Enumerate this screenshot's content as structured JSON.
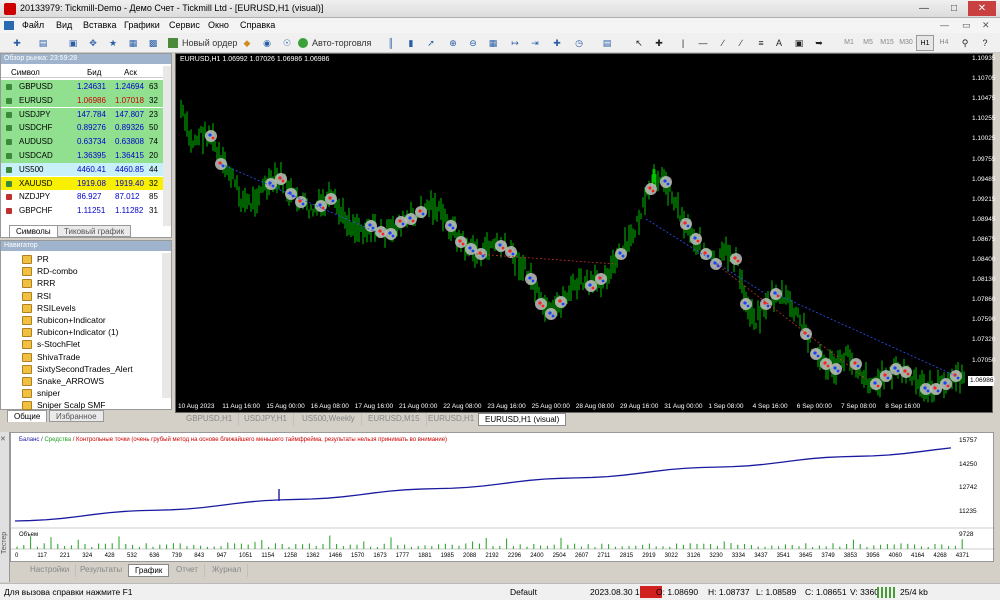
{
  "window": {
    "title": "20133979: Tickmill-Demo - Демо Счет - Tickmill Ltd - [EURUSD,H1 (visual)]"
  },
  "menu": [
    "Файл",
    "Вид",
    "Вставка",
    "Графики",
    "Сервис",
    "Окно",
    "Справка"
  ],
  "toolbar": {
    "new_order": "Новый ордер",
    "autotrading": "Авто-торговля",
    "text_tool": "A",
    "timeframes": [
      "M1",
      "M5",
      "M15",
      "M30",
      "H1",
      "H4",
      "D1",
      "W1",
      "MN"
    ],
    "active_timeframe": "H1"
  },
  "market_watch": {
    "header": "Обзор рынка: 23:59:28",
    "col_symbol": "Символ",
    "col_bid": "Бид",
    "col_ask": "Аск",
    "rows": [
      {
        "symbol": "GBPUSD",
        "bid": "1.24631",
        "ask": "1.24694",
        "spread": "63",
        "bg": "#90e090"
      },
      {
        "symbol": "EURUSD",
        "bid": "1.06986",
        "ask": "1.07018",
        "spread": "32",
        "bg": "#90e090"
      },
      {
        "symbol": "USDJPY",
        "bid": "147.784",
        "ask": "147.807",
        "spread": "23",
        "bg": "#90e090"
      },
      {
        "symbol": "USDCHF",
        "bid": "0.89276",
        "ask": "0.89326",
        "spread": "50",
        "bg": "#90e090"
      },
      {
        "symbol": "AUDUSD",
        "bid": "0.63734",
        "ask": "0.63808",
        "spread": "74",
        "bg": "#90e090"
      },
      {
        "symbol": "USDCAD",
        "bid": "1.36395",
        "ask": "1.36415",
        "spread": "20",
        "bg": "#90e090"
      },
      {
        "symbol": "US500",
        "bid": "4460.41",
        "ask": "4460.85",
        "spread": "44",
        "bg": "#c8f0f8"
      },
      {
        "symbol": "XAUUSD",
        "bid": "1919.08",
        "ask": "1919.40",
        "spread": "32",
        "bg": "#f8f000"
      },
      {
        "symbol": "NZDJPY",
        "bid": "86.927",
        "ask": "87.012",
        "spread": "85",
        "bg": "#ffffff"
      },
      {
        "symbol": "GBPCHF",
        "bid": "1.11251",
        "ask": "1.11282",
        "spread": "31",
        "bg": "#ffffff"
      }
    ],
    "tabs": [
      "Символы",
      "Тиковый график"
    ]
  },
  "navigator": {
    "header": "Навигатор",
    "items": [
      "PR",
      "RD-combo",
      "RRR",
      "RSI",
      "RSILevels",
      "Rubicon+Indicator",
      "Rubicon+Indicator (1)",
      "s-StochFlet",
      "ShivaTrade",
      "SixtySecondTrades_Alert",
      "Snake_ARROWS",
      "sniper",
      "Sniper Scalp SMF"
    ],
    "tabs": [
      "Общие",
      "Избранное"
    ]
  },
  "chart": {
    "symbol_info": "EURUSD,H1  1.06992 1.07026 1.06986 1.06986",
    "price_labels": [
      "1.10935",
      "1.10705",
      "1.10475",
      "1.10255",
      "1.10025",
      "1.09755",
      "1.09485",
      "1.09215",
      "1.08945",
      "1.08675",
      "1.08400",
      "1.08130",
      "1.07860",
      "1.07590",
      "1.07320",
      "1.07050",
      "1.06780"
    ],
    "current_price": "1.06986",
    "time_labels": [
      "10 Aug 2023",
      "11 Aug 16:00",
      "15 Aug 00:00",
      "16 Aug 08:00",
      "17 Aug 16:00",
      "21 Aug 00:00",
      "22 Aug 08:00",
      "23 Aug 16:00",
      "25 Aug 00:00",
      "28 Aug 08:00",
      "29 Aug 16:00",
      "31 Aug 00:00",
      "1 Sep 08:00",
      "4 Sep 16:00",
      "6 Sep 00:00",
      "7 Sep 08:00",
      "8 Sep 16:00"
    ],
    "colors": {
      "candles": "#00c000",
      "background": "#000000",
      "markers": "#c0c0c0",
      "buy": "#1a40ff",
      "sell": "#ff2020"
    }
  },
  "chart_tabs": [
    "GBPUSD,H1",
    "USDJPY,H1",
    "US500,Weekly",
    "EURUSD,M15",
    "EURUSD,H1",
    "EURUSD,H1 (visual)"
  ],
  "chart_tab_active": "EURUSD,H1 (visual)",
  "tester": {
    "legend_balance": "Баланс",
    "legend_equity": "Средства",
    "legend_text": "/ Контрольные точки (очень грубый метод на основе ближайшего меньшего таймфрейма, результаты нельзя принимать во внимание)",
    "y_labels": [
      "15757",
      "14250",
      "12742",
      "11235",
      "9728"
    ],
    "volume_label": "Объем",
    "x_labels": [
      "0",
      "117",
      "221",
      "324",
      "428",
      "532",
      "636",
      "739",
      "843",
      "947",
      "1051",
      "1154",
      "1258",
      "1362",
      "1466",
      "1570",
      "1673",
      "1777",
      "1881",
      "1985",
      "2088",
      "2192",
      "2296",
      "2400",
      "2504",
      "2607",
      "2711",
      "2815",
      "2919",
      "3022",
      "3126",
      "3230",
      "3334",
      "3437",
      "3541",
      "3645",
      "3749",
      "3853",
      "3956",
      "4060",
      "4164",
      "4268",
      "4371"
    ],
    "tabs": [
      "Настройки",
      "Результаты",
      "График",
      "Отчет",
      "Журнал"
    ],
    "active_tab": "График",
    "side_label": "Тестер"
  },
  "status": {
    "help": "Для вызова справки нажмите F1",
    "profile": "Default",
    "datetime": "2023.08.30 10:00",
    "open": "O: 1.08690",
    "high": "H: 1.08737",
    "low": "L: 1.08589",
    "close": "C: 1.08651",
    "volume": "V: 3360",
    "traffic": "25/4 kb"
  }
}
